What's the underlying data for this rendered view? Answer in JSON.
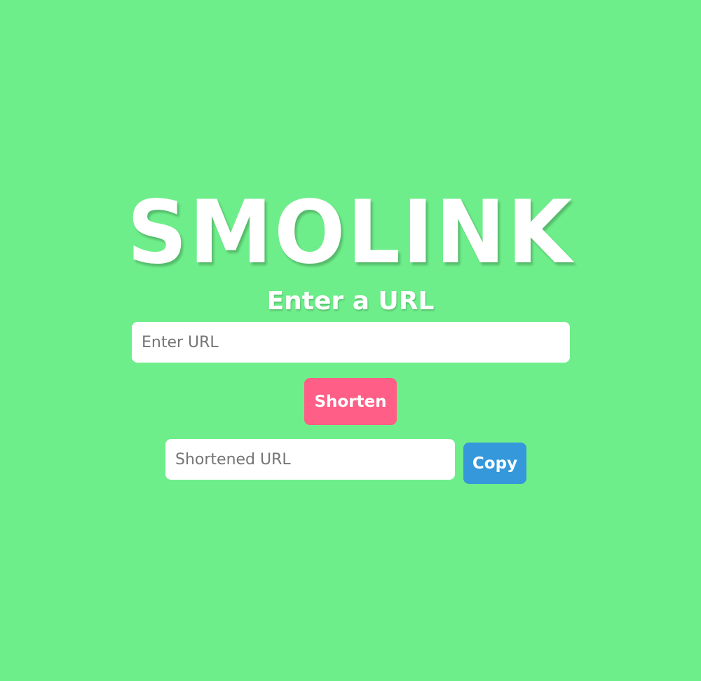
{
  "app": {
    "logo": "SMOLINK",
    "subtitle": "Enter a URL"
  },
  "url_input": {
    "value": "",
    "placeholder": "Enter URL"
  },
  "shorten_button": {
    "label": "Shorten"
  },
  "short_url_output": {
    "value": "",
    "placeholder": "Shortened URL"
  },
  "copy_button": {
    "label": "Copy"
  },
  "colors": {
    "background": "#6eee8a",
    "shorten_button": "#ff5e86",
    "copy_button": "#3498db",
    "text": "#ffffff"
  }
}
